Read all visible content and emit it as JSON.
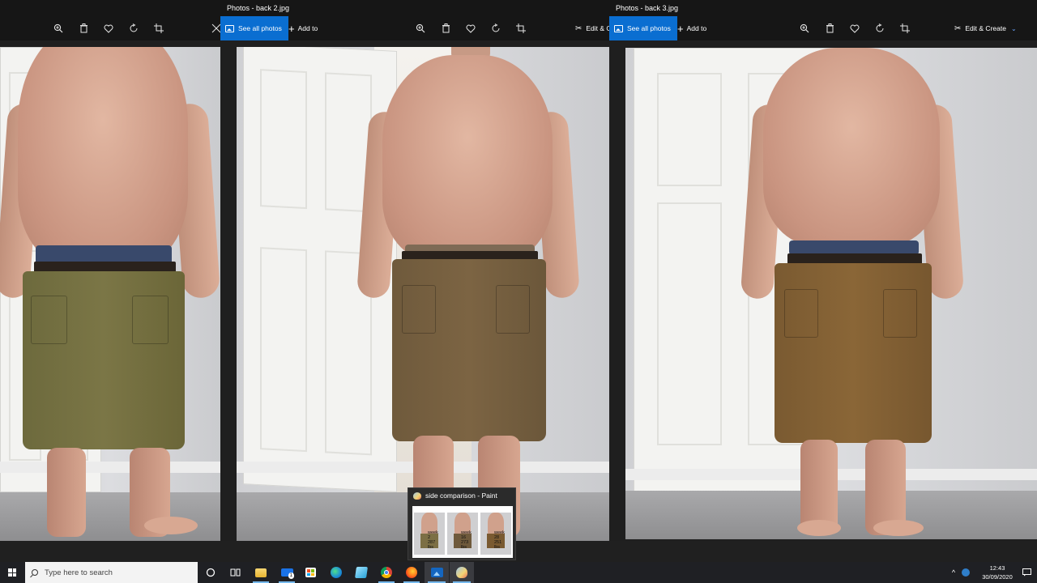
{
  "windows": [
    {
      "id": "win1",
      "title": "",
      "toolbar": {
        "zoom": "zoom-in-icon",
        "delete": "trash-icon",
        "favorite": "heart-icon",
        "rotate": "rotate-icon",
        "crop": "crop-icon",
        "edit": "edit-icon"
      }
    },
    {
      "id": "win2",
      "title": "Photos - back 2.jpg",
      "see_all_label": "See all photos",
      "add_to_label": "Add to",
      "edit_label": "Edit & C"
    },
    {
      "id": "win3",
      "title": "Photos - back 3.jpg",
      "see_all_label": "See all photos",
      "add_to_label": "Add to",
      "edit_label": "Edit & Create"
    }
  ],
  "taskbar": {
    "search_placeholder": "Type here to search",
    "time": "12:43",
    "date": "30/09/2020",
    "apps": [
      "cortana-icon",
      "task-view-icon",
      "file-explorer-icon",
      "mail-icon",
      "store-icon",
      "edge-icon",
      "notepad-icon",
      "chrome-icon",
      "firefox-icon",
      "photos-icon",
      "paint-icon"
    ],
    "mail_badge": "1"
  },
  "thumbnail": {
    "title": "side comparison - Paint",
    "labels": [
      {
        "week": "week",
        "num": "2",
        "weight": "287",
        "unit": "lbs"
      },
      {
        "week": "week",
        "num": "16",
        "weight": "273",
        "unit": "lbs"
      },
      {
        "week": "week",
        "num": "28",
        "weight": "251",
        "unit": "lbs"
      }
    ]
  },
  "colors": {
    "accent": "#0a6ed1",
    "taskbar": "#1f2024",
    "window_bg": "#1f1f1f"
  }
}
